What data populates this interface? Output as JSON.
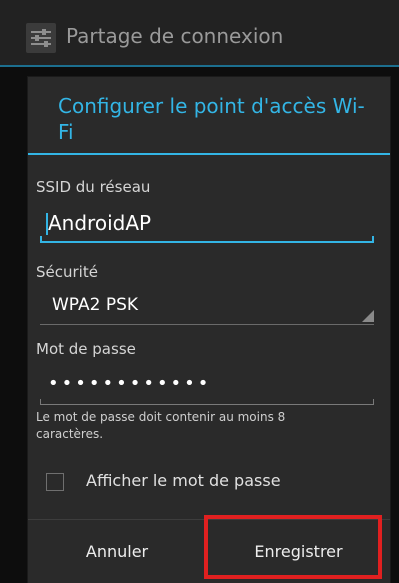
{
  "appbar": {
    "title": "Partage de connexion",
    "icon": "tethering-settings-icon"
  },
  "dialog": {
    "title": "Configurer le point d'accès Wi-Fi",
    "ssid": {
      "label": "SSID du réseau",
      "value": "AndroidAP"
    },
    "security": {
      "label": "Sécurité",
      "value": "WPA2 PSK"
    },
    "password": {
      "label": "Mot de passe",
      "value": "••••••••••••"
    },
    "hint": "Le mot de passe doit contenir au moins 8 caractères.",
    "show_password": {
      "label": "Afficher le mot de passe",
      "checked": false
    },
    "buttons": {
      "cancel": "Annuler",
      "save": "Enregistrer"
    }
  },
  "colors": {
    "accent": "#33b5e5",
    "highlight": "#e02020",
    "dialog_bg": "#2a2a2a"
  }
}
